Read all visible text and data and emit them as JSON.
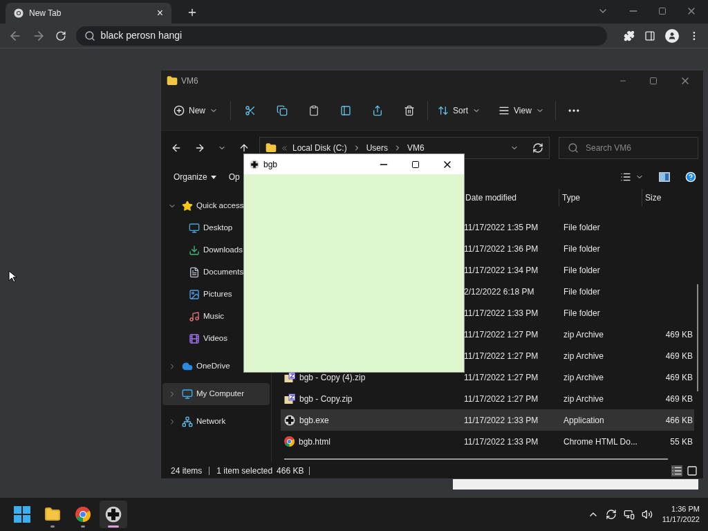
{
  "browser": {
    "tab": {
      "title": "New Tab",
      "close": "×"
    },
    "omnibox": {
      "value": "black perosn hangi"
    }
  },
  "explorer": {
    "title": "VM6",
    "command_bar": {
      "new": "New",
      "sort": "Sort",
      "view": "View"
    },
    "address": {
      "path": [
        "Local Disk (C:)",
        "Users",
        "VM6"
      ],
      "search_placeholder": "Search VM6"
    },
    "toolbar": {
      "organize": "Organize",
      "open": "Op"
    },
    "nav": [
      {
        "label": "Quick access",
        "kind": "star",
        "expanded": true,
        "selected": false,
        "children": [
          {
            "label": "Desktop",
            "kind": "desktop",
            "selected": false
          },
          {
            "label": "Downloads",
            "kind": "download",
            "selected": false
          },
          {
            "label": "Documents",
            "kind": "document",
            "selected": false
          },
          {
            "label": "Pictures",
            "kind": "pictures",
            "selected": false
          },
          {
            "label": "Music",
            "kind": "music",
            "selected": false
          },
          {
            "label": "Videos",
            "kind": "videos",
            "selected": false
          }
        ]
      },
      {
        "label": "OneDrive",
        "kind": "cloud",
        "expanded": false,
        "selected": false
      },
      {
        "label": "My Computer",
        "kind": "computer",
        "expanded": false,
        "selected": true
      },
      {
        "label": "Network",
        "kind": "network",
        "expanded": false,
        "selected": false
      }
    ],
    "columns": [
      "Date modified",
      "Type",
      "Size"
    ],
    "rows": [
      {
        "date": "11/17/2022 1:35 PM",
        "type": "File folder",
        "selected": false
      },
      {
        "date": "11/17/2022 1:36 PM",
        "type": "File folder",
        "selected": false
      },
      {
        "date": "11/17/2022 1:34 PM",
        "type": "File folder",
        "selected": false
      },
      {
        "date": "2/12/2022 6:18 PM",
        "type": "File folder",
        "selected": false
      },
      {
        "date": "11/17/2022 1:33 PM",
        "type": "File folder",
        "selected": false
      },
      {
        "date": "11/17/2022 1:27 PM",
        "type": "zip Archive",
        "size": "469 KB",
        "selected": false
      },
      {
        "date": "11/17/2022 1:27 PM",
        "type": "zip Archive",
        "size": "469 KB",
        "selected": false
      },
      {
        "name": "bgb - Copy (4).zip",
        "kind": "zip",
        "date": "11/17/2022 1:27 PM",
        "type": "zip Archive",
        "size": "469 KB",
        "selected": false
      },
      {
        "name": "bgb - Copy.zip",
        "kind": "zip",
        "date": "11/17/2022 1:27 PM",
        "type": "zip Archive",
        "size": "469 KB",
        "selected": false
      },
      {
        "name": "bgb.exe",
        "kind": "app",
        "date": "11/17/2022 1:33 PM",
        "type": "Application",
        "size": "466 KB",
        "selected": true
      },
      {
        "name": "bgb.html",
        "kind": "html",
        "date": "11/17/2022 1:33 PM",
        "type": "Chrome HTML Do...",
        "size": "55 KB",
        "selected": false
      }
    ],
    "status": {
      "items": "24 items",
      "selection": "1 item selected",
      "size": "466 KB"
    }
  },
  "bgb_window": {
    "title": "bgb"
  },
  "taskbar": {
    "apps": [
      {
        "kind": "explorer",
        "active": false
      },
      {
        "kind": "chrome",
        "active": false
      },
      {
        "kind": "bgb",
        "active": true
      }
    ],
    "time": "1:36 PM",
    "date": "11/17/2022"
  }
}
